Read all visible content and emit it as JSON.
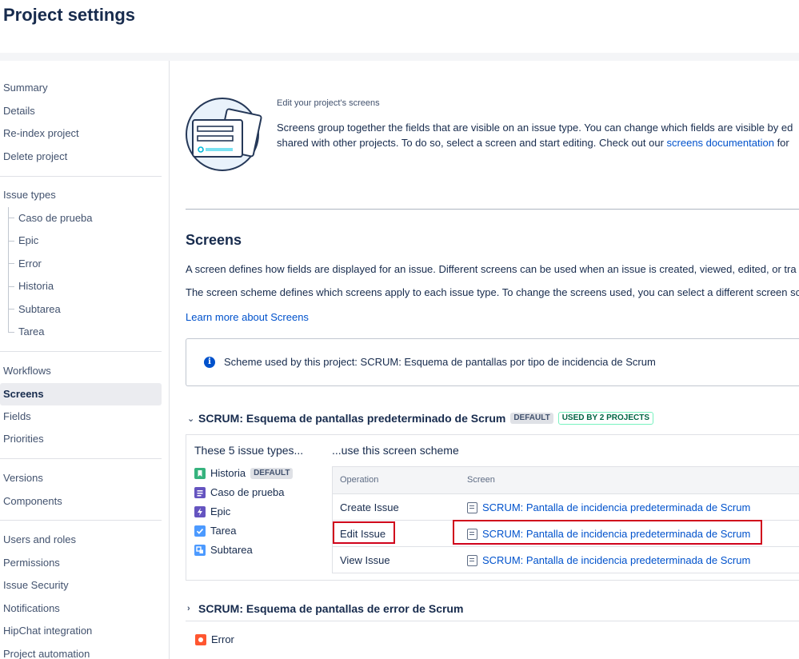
{
  "header": {
    "title": "Project settings"
  },
  "sidebar": {
    "group1": [
      "Summary",
      "Details",
      "Re-index project",
      "Delete project"
    ],
    "issue_types_label": "Issue types",
    "issue_type_children": [
      "Caso de prueba",
      "Epic",
      "Error",
      "Historia",
      "Subtarea",
      "Tarea"
    ],
    "group3": [
      "Workflows",
      "Screens",
      "Fields",
      "Priorities"
    ],
    "active": "Screens",
    "group4": [
      "Versions",
      "Components"
    ],
    "group5": [
      "Users and roles",
      "Permissions",
      "Issue Security",
      "Notifications",
      "HipChat integration",
      "Project automation"
    ]
  },
  "intro": {
    "title": "Edit your project's screens",
    "line1": "Screens group together the fields that are visible on an issue type. You can change which fields are visible by ed",
    "line2_prefix": "shared with other projects. To do so, select a screen and start editing. Check out our ",
    "line2_link": "screens documentation",
    "line2_suffix": " for"
  },
  "screens_section": {
    "title": "Screens",
    "para1": "A screen defines how fields are displayed for an issue. Different screens can be used when an issue is created, viewed, edited, or tra",
    "para2": "The screen scheme defines which screens apply to each issue type. To change the screens used, you can select a different screen sc",
    "learn_more": "Learn more about Screens",
    "info": "Scheme used by this project: SCRUM: Esquema de pantallas por tipo de incidencia de Scrum"
  },
  "scheme1": {
    "name": "SCRUM: Esquema de pantallas predeterminado de Scrum",
    "badge_default": "DEFAULT",
    "badge_used": "USED BY 2 PROJECTS",
    "left_title": "These 5 issue types...",
    "right_title": "...use this screen scheme",
    "issue_types": [
      {
        "name": "Historia",
        "badge": "DEFAULT",
        "color": "#36B37E",
        "icon": "bookmark-icon"
      },
      {
        "name": "Caso de prueba",
        "badge": "",
        "color": "#6554C0",
        "icon": "list-icon"
      },
      {
        "name": "Epic",
        "badge": "",
        "color": "#6554C0",
        "icon": "lightning-icon"
      },
      {
        "name": "Tarea",
        "badge": "",
        "color": "#4C9AFF",
        "icon": "checkbox-icon"
      },
      {
        "name": "Subtarea",
        "badge": "",
        "color": "#4C9AFF",
        "icon": "subtask-icon"
      }
    ],
    "table_headers": {
      "operation": "Operation",
      "screen": "Screen"
    },
    "rows": [
      {
        "operation": "Create Issue",
        "screen": "SCRUM: Pantalla de incidencia predeterminada de Scrum"
      },
      {
        "operation": "Edit Issue",
        "screen": "SCRUM: Pantalla de incidencia predeterminada de Scrum"
      },
      {
        "operation": "View Issue",
        "screen": "SCRUM: Pantalla de incidencia predeterminada de Scrum"
      }
    ]
  },
  "scheme2": {
    "name": "SCRUM: Esquema de pantallas de error de Scrum",
    "issue_type": {
      "name": "Error",
      "color": "#FF5630",
      "icon": "bug-icon"
    }
  },
  "colors": {
    "link": "#0052CC",
    "highlight": "#d0021b",
    "text": "#172B4D"
  }
}
